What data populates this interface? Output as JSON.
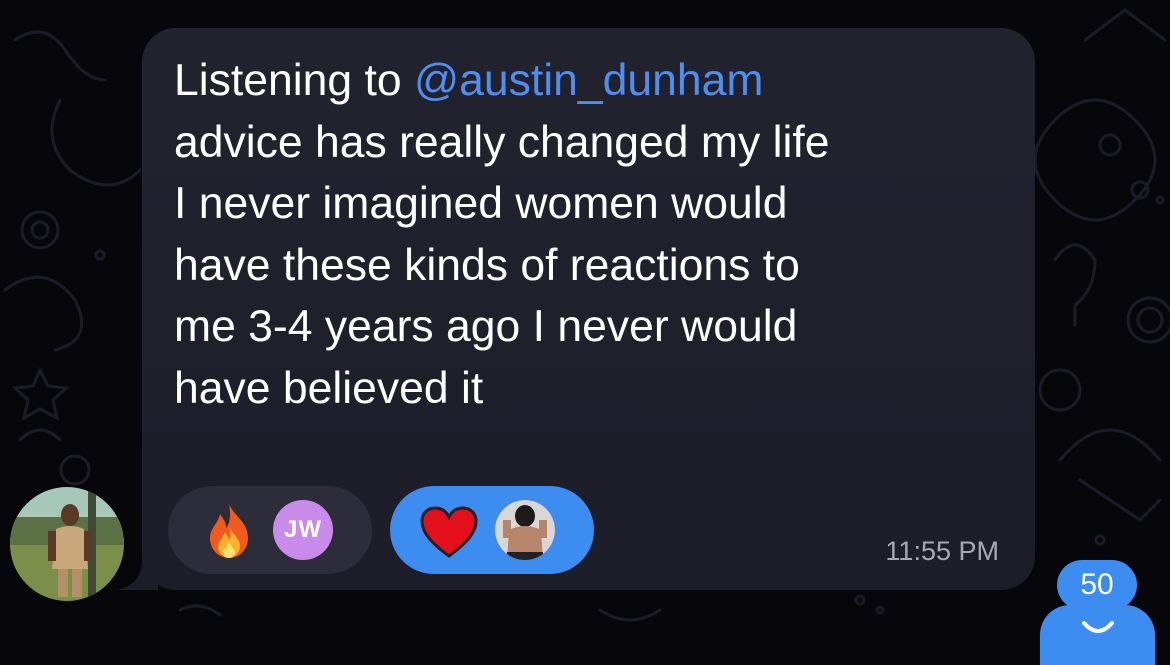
{
  "message": {
    "mention": "@austin_dunham",
    "text_before_mention": "Listening to ",
    "text_after_mention": "\nadvice has really changed my life\nI never imagined women would\nhave these kinds of reactions to\nme 3-4 years ago I never would\nhave believed it",
    "time": "11:55 PM"
  },
  "reactions": [
    {
      "emoji": "fire-icon",
      "user_initials": "JW",
      "badge_color": "#c98bea",
      "selected": false
    },
    {
      "emoji": "heart-icon",
      "user_avatar": "photo",
      "selected": true
    }
  ],
  "unread_count": "50",
  "colors": {
    "accent": "#3d8cf0",
    "mention": "#4f8df0",
    "bubble": "#23222f",
    "background": "#07070b"
  }
}
